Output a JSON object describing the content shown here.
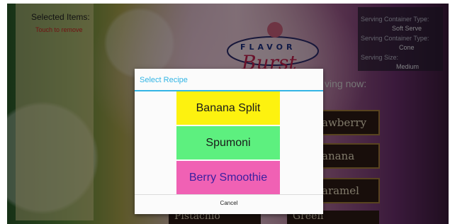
{
  "colors": {
    "dialog_accent": "#33b5e5",
    "banana_split": "#fdf20f",
    "spumoni": "#5df07f",
    "berry_smoothie": "#f061b4",
    "hint_red": "#cc2222"
  },
  "selected": {
    "title": "Selected Items:",
    "hint": "Touch to remove"
  },
  "info": {
    "container_type_label_1": "Serving Container Type:",
    "container_type_value_1": "Soft Serve",
    "container_type_label_2": "Serving Container Type:",
    "container_type_value_2": "Cone",
    "size_label": "Serving Size:",
    "size_value": "Medium"
  },
  "logo": {
    "top_text": "FLAVOR",
    "script_text": "Burst"
  },
  "background": {
    "serving_now": "ving now:",
    "tiles": [
      "awberry",
      "anana",
      "aramel"
    ],
    "bottom_tiles": [
      "Pistachio",
      "Green"
    ]
  },
  "dialog": {
    "title": "Select Recipe",
    "recipes": [
      "Banana Split",
      "Spumoni",
      "Berry Smoothie"
    ],
    "cancel": "Cancel"
  }
}
